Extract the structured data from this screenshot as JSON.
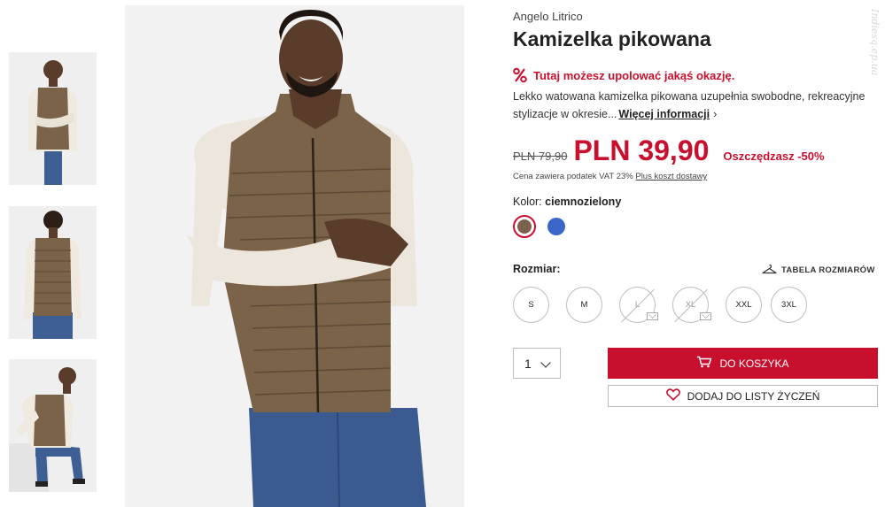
{
  "product": {
    "brand": "Angelo Litrico",
    "title": "Kamizelka pikowana",
    "deal_text": "Tutaj możesz upolować jakąś okazję.",
    "description": "Lekko watowana kamizelka pikowana uzupełnia swobodne, rekreacyjne stylizacje w okresie...",
    "more_link": "Więcej informacji",
    "old_price": "PLN 79,90",
    "new_price": "PLN 39,90",
    "savings": "Oszczędzasz -50%",
    "vat_note": "Cena zawiera podatek VAT 23%",
    "shipping_link": "Plus koszt dostawy",
    "color_label": "Kolor:",
    "color_value": "ciemnozielony",
    "colors": [
      {
        "name": "ciemnozielony",
        "hex": "#7a6349",
        "selected": true
      },
      {
        "name": "niebieski",
        "hex": "#3a66c8",
        "selected": false
      }
    ],
    "size_label": "Rozmiar:",
    "size_table_link": "TABELA ROZMIARÓW",
    "sizes": [
      {
        "label": "S",
        "available": true
      },
      {
        "label": "M",
        "available": true
      },
      {
        "label": "L",
        "available": false
      },
      {
        "label": "XL",
        "available": false
      },
      {
        "label": "XXL",
        "available": true
      },
      {
        "label": "3XL",
        "available": true
      }
    ],
    "quantity": "1",
    "cart_button": "DO KOSZYKA",
    "wishlist_button": "DODAJ DO LISTY ŻYCZEŃ"
  },
  "watermark": "Indiesq.ep.ua",
  "theme": {
    "accent": "#c8102e",
    "text": "#222222"
  },
  "icons": {
    "deal": "percent-icon",
    "more": "chevron-right-icon",
    "size_table": "hanger-icon",
    "cart": "cart-icon",
    "wishlist": "heart-icon",
    "quantity": "chevron-down-icon"
  }
}
